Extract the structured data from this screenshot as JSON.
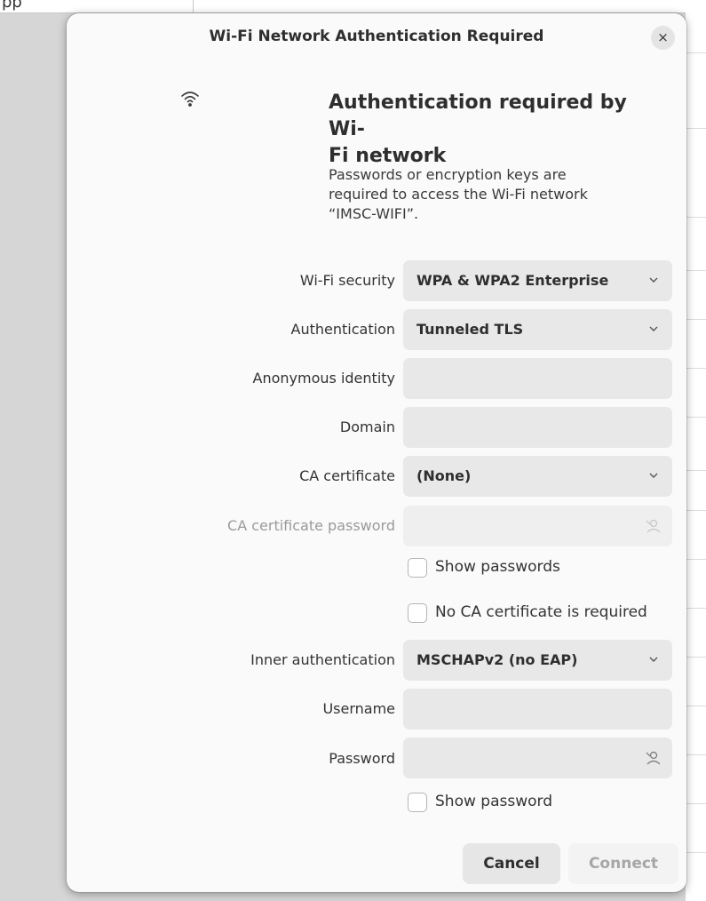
{
  "background": {
    "partial_text": "pp"
  },
  "dialog": {
    "title": "Wi-Fi Network Authentication Required",
    "close_glyph": "×",
    "icon": "wifi-icon",
    "heading_line1": "Authentication required by Wi-",
    "heading_line2": "Fi network",
    "description_line1": "Passwords or encryption keys are",
    "description_line2": "required to access the Wi-Fi network",
    "description_line3": "“IMSC-WIFI”."
  },
  "form": {
    "wifi_security": {
      "label": "Wi-Fi security",
      "value": "WPA & WPA2 Enterprise"
    },
    "authentication": {
      "label": "Authentication",
      "value": "Tunneled TLS"
    },
    "anonymous_identity": {
      "label": "Anonymous identity",
      "value": ""
    },
    "domain": {
      "label": "Domain",
      "value": ""
    },
    "ca_certificate": {
      "label": "CA certificate",
      "value": "(None)"
    },
    "ca_certificate_password": {
      "label": "CA certificate password",
      "value": "",
      "disabled": true
    },
    "show_passwords": {
      "label": "Show passwords",
      "checked": false
    },
    "no_ca_required": {
      "label": "No CA certificate is required",
      "checked": false
    },
    "inner_authentication": {
      "label": "Inner authentication",
      "value": "MSCHAPv2 (no EAP)"
    },
    "username": {
      "label": "Username",
      "value": ""
    },
    "password": {
      "label": "Password",
      "value": ""
    },
    "show_password": {
      "label": "Show password",
      "checked": false
    }
  },
  "buttons": {
    "cancel": "Cancel",
    "connect": "Connect"
  },
  "colors": {
    "dialog_bg": "#fafafa",
    "field_bg": "#e8e8e8",
    "disabled_text": "#a6a6a6"
  }
}
